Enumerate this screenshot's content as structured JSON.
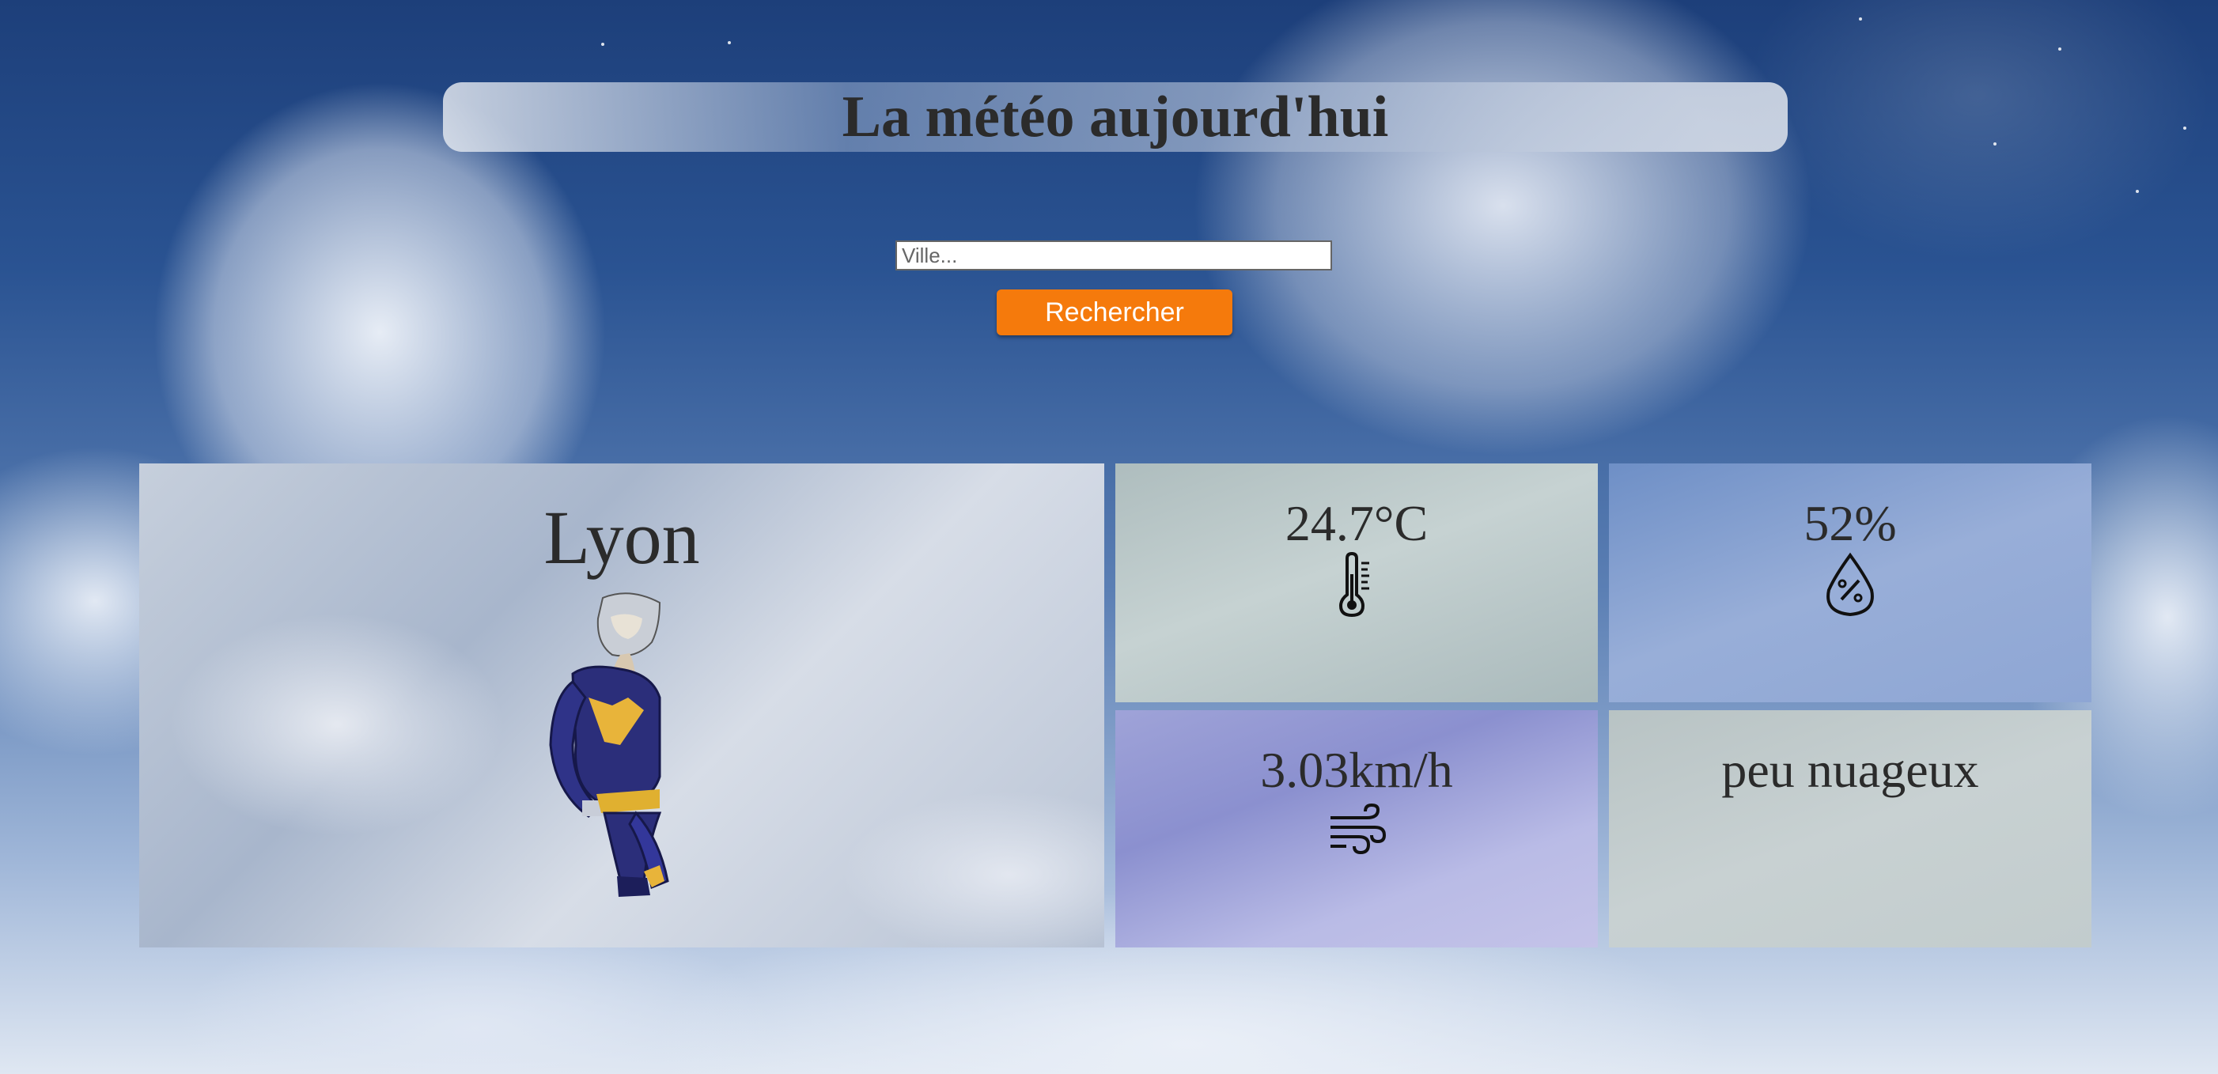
{
  "header": {
    "title": "La météo aujourd'hui"
  },
  "search": {
    "placeholder": "Ville...",
    "value": "",
    "button_label": "Rechercher"
  },
  "weather": {
    "city": "Lyon",
    "temperature": "24.7°C",
    "humidity": "52%",
    "wind": "3.03km/h",
    "description": "peu nuageux"
  },
  "icons": {
    "temperature": "thermometer-icon",
    "humidity": "humidity-drop-icon",
    "wind": "wind-icon"
  },
  "colors": {
    "button": "#f57a0c",
    "text": "#2b2b2b"
  }
}
